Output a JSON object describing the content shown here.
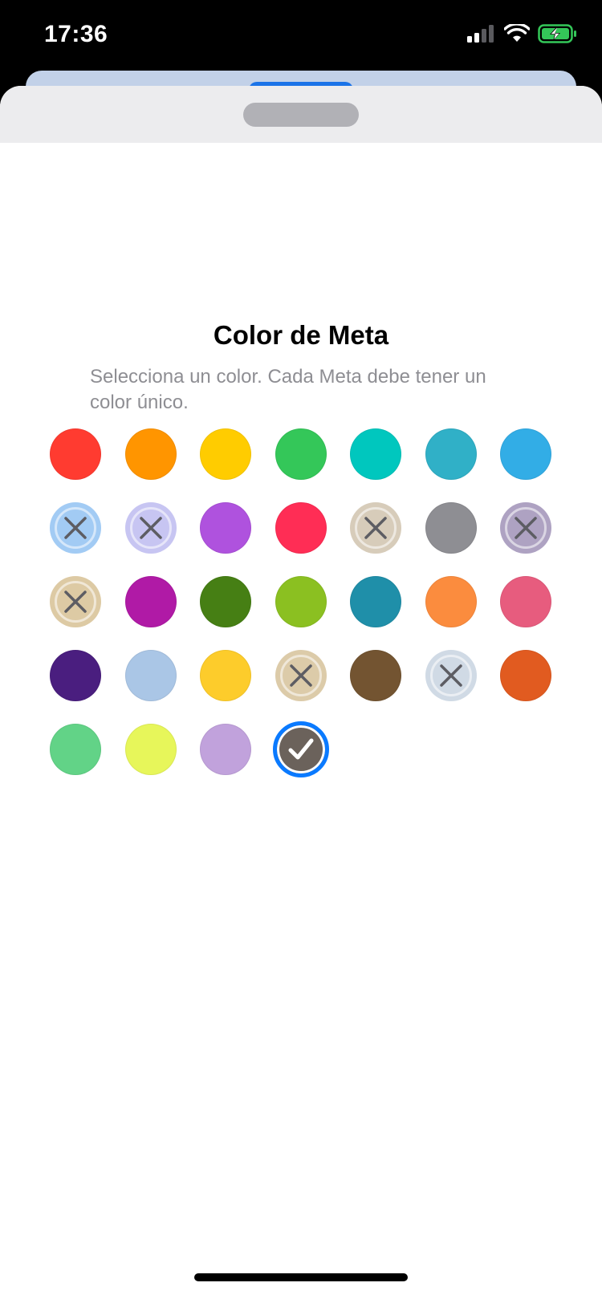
{
  "status_bar": {
    "time": "17:36",
    "icons": [
      "cellular-signal-icon",
      "wifi-icon",
      "battery-charging-icon"
    ],
    "battery_color": "#34c759"
  },
  "sheet": {
    "title": "Color de Meta",
    "subtitle": "Selecciona un color. Cada Meta debe tener un color único."
  },
  "colors": [
    {
      "hex": "#ff3b30",
      "state": "available"
    },
    {
      "hex": "#ff9500",
      "state": "available"
    },
    {
      "hex": "#ffcc00",
      "state": "available"
    },
    {
      "hex": "#34c759",
      "state": "available"
    },
    {
      "hex": "#00c7be",
      "state": "available"
    },
    {
      "hex": "#30b0c7",
      "state": "available"
    },
    {
      "hex": "#32ade6",
      "state": "available"
    },
    {
      "hex": "#a2cbf4",
      "state": "used"
    },
    {
      "hex": "#c7c5f2",
      "state": "used"
    },
    {
      "hex": "#af52de",
      "state": "available"
    },
    {
      "hex": "#ff2d55",
      "state": "available"
    },
    {
      "hex": "#d7ccba",
      "state": "used"
    },
    {
      "hex": "#8e8e93",
      "state": "available"
    },
    {
      "hex": "#aea2c2",
      "state": "used"
    },
    {
      "hex": "#ddcaa4",
      "state": "used"
    },
    {
      "hex": "#b01aa6",
      "state": "available"
    },
    {
      "hex": "#467f14",
      "state": "available"
    },
    {
      "hex": "#8bc021",
      "state": "available"
    },
    {
      "hex": "#1f8fa9",
      "state": "available"
    },
    {
      "hex": "#fb8c3e",
      "state": "available"
    },
    {
      "hex": "#e75c7e",
      "state": "available"
    },
    {
      "hex": "#4a1e7f",
      "state": "available"
    },
    {
      "hex": "#aac6e6",
      "state": "available"
    },
    {
      "hex": "#fdcc2b",
      "state": "available"
    },
    {
      "hex": "#dccba9",
      "state": "used"
    },
    {
      "hex": "#735431",
      "state": "available"
    },
    {
      "hex": "#d0dae5",
      "state": "used"
    },
    {
      "hex": "#e15b20",
      "state": "available"
    },
    {
      "hex": "#62d387",
      "state": "available"
    },
    {
      "hex": "#e7f65a",
      "state": "available"
    },
    {
      "hex": "#c1a2dc",
      "state": "available"
    },
    {
      "hex": "#6b625b",
      "state": "selected"
    }
  ],
  "accent_color": "#0a7aff"
}
